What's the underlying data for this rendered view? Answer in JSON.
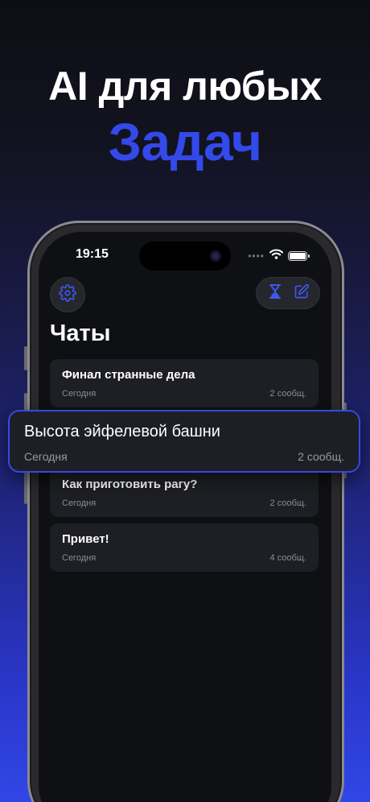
{
  "hero": {
    "line1": "AI для любых",
    "line2": "Задач"
  },
  "status": {
    "time": "19:15",
    "dots": "••••"
  },
  "header": {
    "title": "Чаты"
  },
  "chats": [
    {
      "title": "Финал странные дела",
      "date": "Сегодня",
      "count": "2 сообщ."
    },
    {
      "title": "Высота эйфелевой башни",
      "date": "Сегодня",
      "count": "2 сообщ."
    },
    {
      "title": "Как приготовить рагу?",
      "date": "Сегодня",
      "count": "2 сообщ."
    },
    {
      "title": "Привет!",
      "date": "Сегодня",
      "count": "4 сообщ."
    }
  ],
  "icons": {
    "settings": "gear-icon",
    "history": "hourglass-icon",
    "new_chat": "compose-icon"
  },
  "colors": {
    "accent": "#3349ea",
    "card": "#1e1f24",
    "screen": "#0f1013"
  }
}
